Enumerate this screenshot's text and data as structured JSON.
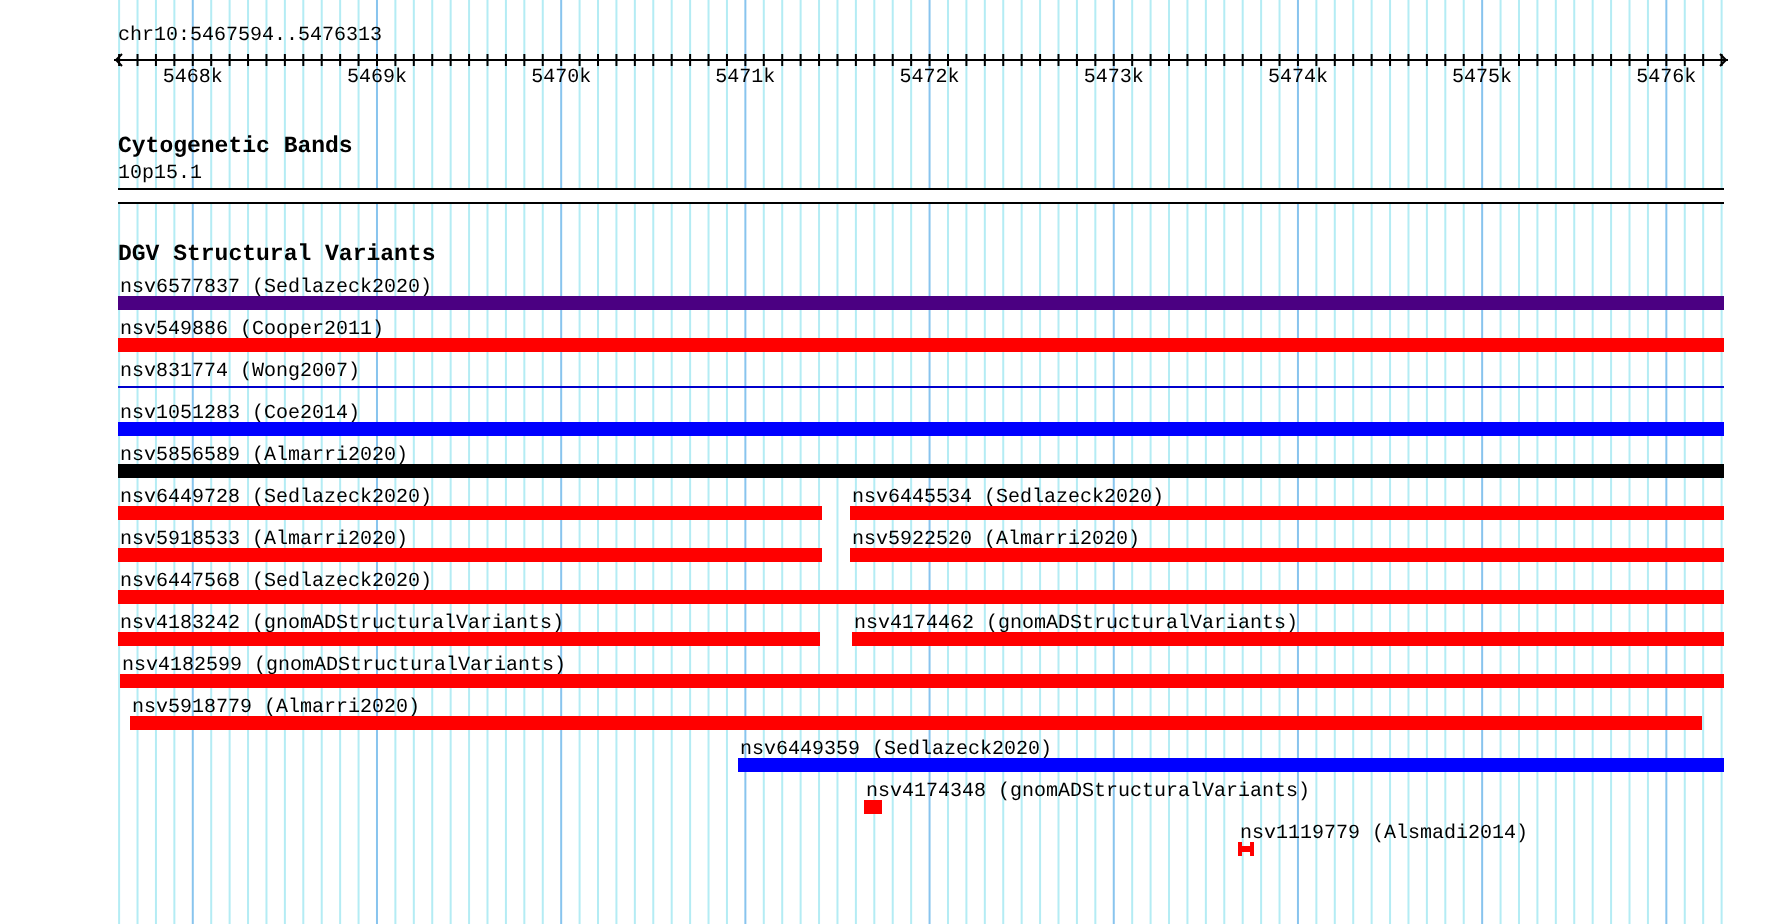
{
  "region": {
    "title": "chr10:5467594..5476313"
  },
  "ruler": {
    "ticks": [
      "5468k",
      "5469k",
      "5470k",
      "5471k",
      "5472k",
      "5473k",
      "5474k",
      "5475k",
      "5476k"
    ]
  },
  "tracks": [
    {
      "kind": "cytoband",
      "title": "Cytogenetic Bands",
      "features": [
        {
          "label": "10p15.1",
          "color": "#ffffff"
        }
      ]
    },
    {
      "kind": "variants",
      "title": "DGV Structural Variants",
      "rows": [
        [
          {
            "label": "nsv6577837 (Sedlazeck2020)",
            "kind": "bar",
            "color": "#4b0082"
          }
        ],
        [
          {
            "label": "nsv549886 (Cooper2011)",
            "kind": "bar",
            "color": "#ff0000"
          }
        ],
        [
          {
            "label": "nsv831774 (Wong2007)",
            "kind": "line",
            "color": "#0000cc"
          }
        ],
        [
          {
            "label": "nsv1051283 (Coe2014)",
            "kind": "bar",
            "color": "#0000ff"
          }
        ],
        [
          {
            "label": "nsv5856589 (Almarri2020)",
            "kind": "bar",
            "color": "#000000"
          }
        ],
        [
          {
            "label": "nsv6449728 (Sedlazeck2020)",
            "kind": "bar",
            "color": "#ff0000"
          },
          {
            "label": "nsv6445534 (Sedlazeck2020)",
            "kind": "bar",
            "color": "#ff0000"
          }
        ],
        [
          {
            "label": "nsv5918533 (Almarri2020)",
            "kind": "bar",
            "color": "#ff0000"
          },
          {
            "label": "nsv5922520 (Almarri2020)",
            "kind": "bar",
            "color": "#ff0000"
          }
        ],
        [
          {
            "label": "nsv6447568 (Sedlazeck2020)",
            "kind": "bar",
            "color": "#ff0000"
          }
        ],
        [
          {
            "label": "nsv4183242 (gnomADStructuralVariants)",
            "kind": "bar",
            "color": "#ff0000"
          },
          {
            "label": "nsv4174462 (gnomADStructuralVariants)",
            "kind": "bar",
            "color": "#ff0000"
          }
        ],
        [
          {
            "label": "nsv4182599 (gnomADStructuralVariants)",
            "kind": "bar",
            "color": "#ff0000"
          }
        ],
        [
          {
            "label": "nsv5918779 (Almarri2020)",
            "kind": "bar",
            "color": "#ff0000"
          }
        ],
        [
          {
            "label": "nsv6449359 (Sedlazeck2020)",
            "kind": "bar",
            "color": "#0000ff"
          }
        ],
        [
          {
            "label": "nsv4174348 (gnomADStructuralVariants)",
            "kind": "bar",
            "color": "#ff0000"
          }
        ],
        [
          {
            "label": "nsv1119779 (Alsmadi2014)",
            "kind": "mark",
            "color": "#ff0000"
          }
        ]
      ]
    }
  ]
}
